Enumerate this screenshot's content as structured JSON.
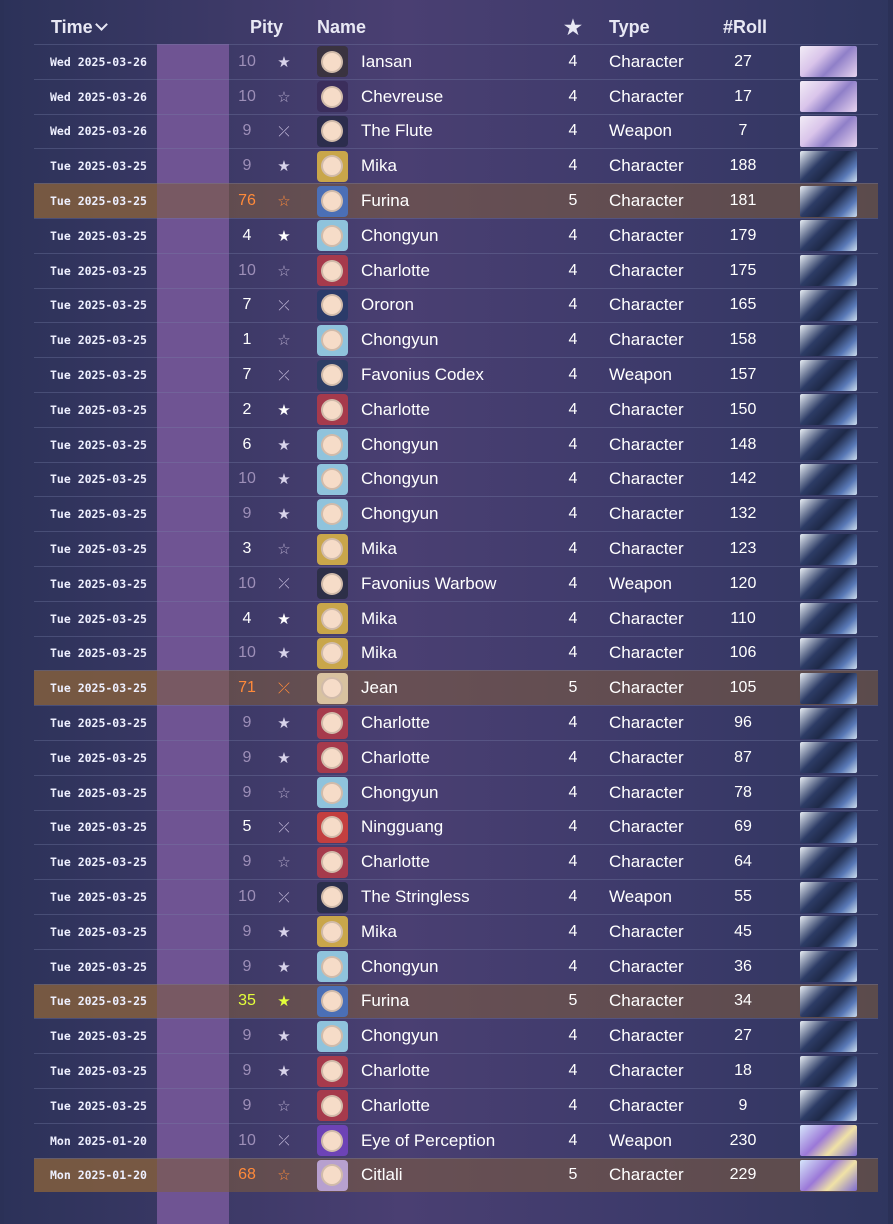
{
  "header": {
    "time": "Time",
    "pity": "Pity",
    "name": "Name",
    "star": "★",
    "type": "Type",
    "roll": "#Roll"
  },
  "rows": [
    {
      "time": "Wed 2025-03-26",
      "pity": "10",
      "icon": "star",
      "name": "Iansan",
      "rarity": "4",
      "type": "Character",
      "roll": "27",
      "banner": "a",
      "hl": "dim"
    },
    {
      "time": "Wed 2025-03-26",
      "pity": "10",
      "icon": "star-outline",
      "name": "Chevreuse",
      "rarity": "4",
      "type": "Character",
      "roll": "17",
      "banner": "a",
      "hl": "dim"
    },
    {
      "time": "Wed 2025-03-26",
      "pity": "9",
      "icon": "slash",
      "name": "The Flute",
      "rarity": "4",
      "type": "Weapon",
      "roll": "7",
      "banner": "a",
      "hl": "dim"
    },
    {
      "time": "Tue 2025-03-25",
      "pity": "9",
      "icon": "star",
      "name": "Mika",
      "rarity": "4",
      "type": "Character",
      "roll": "188",
      "banner": "b",
      "hl": "dim"
    },
    {
      "time": "Tue 2025-03-25",
      "pity": "76",
      "icon": "star-outline",
      "name": "Furina",
      "rarity": "5",
      "type": "Character",
      "roll": "181",
      "banner": "b",
      "hl": "orange"
    },
    {
      "time": "Tue 2025-03-25",
      "pity": "4",
      "icon": "star",
      "name": "Chongyun",
      "rarity": "4",
      "type": "Character",
      "roll": "179",
      "banner": "b",
      "hl": "bright"
    },
    {
      "time": "Tue 2025-03-25",
      "pity": "10",
      "icon": "star-outline",
      "name": "Charlotte",
      "rarity": "4",
      "type": "Character",
      "roll": "175",
      "banner": "b",
      "hl": "dim"
    },
    {
      "time": "Tue 2025-03-25",
      "pity": "7",
      "icon": "slash",
      "name": "Ororon",
      "rarity": "4",
      "type": "Character",
      "roll": "165",
      "banner": "b",
      "hl": "mid"
    },
    {
      "time": "Tue 2025-03-25",
      "pity": "1",
      "icon": "star-outline",
      "name": "Chongyun",
      "rarity": "4",
      "type": "Character",
      "roll": "158",
      "banner": "b",
      "hl": "bright"
    },
    {
      "time": "Tue 2025-03-25",
      "pity": "7",
      "icon": "slash",
      "name": "Favonius Codex",
      "rarity": "4",
      "type": "Weapon",
      "roll": "157",
      "banner": "b",
      "hl": "mid"
    },
    {
      "time": "Tue 2025-03-25",
      "pity": "2",
      "icon": "star",
      "name": "Charlotte",
      "rarity": "4",
      "type": "Character",
      "roll": "150",
      "banner": "b",
      "hl": "bright"
    },
    {
      "time": "Tue 2025-03-25",
      "pity": "6",
      "icon": "star",
      "name": "Chongyun",
      "rarity": "4",
      "type": "Character",
      "roll": "148",
      "banner": "b",
      "hl": "mid"
    },
    {
      "time": "Tue 2025-03-25",
      "pity": "10",
      "icon": "star",
      "name": "Chongyun",
      "rarity": "4",
      "type": "Character",
      "roll": "142",
      "banner": "b",
      "hl": "dim"
    },
    {
      "time": "Tue 2025-03-25",
      "pity": "9",
      "icon": "star",
      "name": "Chongyun",
      "rarity": "4",
      "type": "Character",
      "roll": "132",
      "banner": "b",
      "hl": "dim"
    },
    {
      "time": "Tue 2025-03-25",
      "pity": "3",
      "icon": "star-outline",
      "name": "Mika",
      "rarity": "4",
      "type": "Character",
      "roll": "123",
      "banner": "b",
      "hl": "bright"
    },
    {
      "time": "Tue 2025-03-25",
      "pity": "10",
      "icon": "slash",
      "name": "Favonius Warbow",
      "rarity": "4",
      "type": "Weapon",
      "roll": "120",
      "banner": "b",
      "hl": "dim"
    },
    {
      "time": "Tue 2025-03-25",
      "pity": "4",
      "icon": "star",
      "name": "Mika",
      "rarity": "4",
      "type": "Character",
      "roll": "110",
      "banner": "b",
      "hl": "bright"
    },
    {
      "time": "Tue 2025-03-25",
      "pity": "10",
      "icon": "star",
      "name": "Mika",
      "rarity": "4",
      "type": "Character",
      "roll": "106",
      "banner": "b",
      "hl": "dim"
    },
    {
      "time": "Tue 2025-03-25",
      "pity": "71",
      "icon": "slash",
      "name": "Jean",
      "rarity": "5",
      "type": "Character",
      "roll": "105",
      "banner": "b",
      "hl": "orange"
    },
    {
      "time": "Tue 2025-03-25",
      "pity": "9",
      "icon": "star",
      "name": "Charlotte",
      "rarity": "4",
      "type": "Character",
      "roll": "96",
      "banner": "b",
      "hl": "dim"
    },
    {
      "time": "Tue 2025-03-25",
      "pity": "9",
      "icon": "star",
      "name": "Charlotte",
      "rarity": "4",
      "type": "Character",
      "roll": "87",
      "banner": "b",
      "hl": "dim"
    },
    {
      "time": "Tue 2025-03-25",
      "pity": "9",
      "icon": "star-outline",
      "name": "Chongyun",
      "rarity": "4",
      "type": "Character",
      "roll": "78",
      "banner": "b",
      "hl": "dim"
    },
    {
      "time": "Tue 2025-03-25",
      "pity": "5",
      "icon": "slash",
      "name": "Ningguang",
      "rarity": "4",
      "type": "Character",
      "roll": "69",
      "banner": "b",
      "hl": "bright"
    },
    {
      "time": "Tue 2025-03-25",
      "pity": "9",
      "icon": "star-outline",
      "name": "Charlotte",
      "rarity": "4",
      "type": "Character",
      "roll": "64",
      "banner": "b",
      "hl": "dim"
    },
    {
      "time": "Tue 2025-03-25",
      "pity": "10",
      "icon": "slash",
      "name": "The Stringless",
      "rarity": "4",
      "type": "Weapon",
      "roll": "55",
      "banner": "b",
      "hl": "dim"
    },
    {
      "time": "Tue 2025-03-25",
      "pity": "9",
      "icon": "star",
      "name": "Mika",
      "rarity": "4",
      "type": "Character",
      "roll": "45",
      "banner": "b",
      "hl": "dim"
    },
    {
      "time": "Tue 2025-03-25",
      "pity": "9",
      "icon": "star",
      "name": "Chongyun",
      "rarity": "4",
      "type": "Character",
      "roll": "36",
      "banner": "b",
      "hl": "dim"
    },
    {
      "time": "Tue 2025-03-25",
      "pity": "35",
      "icon": "star",
      "name": "Furina",
      "rarity": "5",
      "type": "Character",
      "roll": "34",
      "banner": "b",
      "hl": "yellow"
    },
    {
      "time": "Tue 2025-03-25",
      "pity": "9",
      "icon": "star",
      "name": "Chongyun",
      "rarity": "4",
      "type": "Character",
      "roll": "27",
      "banner": "b",
      "hl": "dim"
    },
    {
      "time": "Tue 2025-03-25",
      "pity": "9",
      "icon": "star",
      "name": "Charlotte",
      "rarity": "4",
      "type": "Character",
      "roll": "18",
      "banner": "b",
      "hl": "dim"
    },
    {
      "time": "Tue 2025-03-25",
      "pity": "9",
      "icon": "star-outline",
      "name": "Charlotte",
      "rarity": "4",
      "type": "Character",
      "roll": "9",
      "banner": "b",
      "hl": "dim"
    },
    {
      "time": "Mon 2025-01-20",
      "pity": "10",
      "icon": "slash",
      "name": "Eye of Perception",
      "rarity": "4",
      "type": "Weapon",
      "roll": "230",
      "banner": "c",
      "hl": "dim"
    },
    {
      "time": "Mon 2025-01-20",
      "pity": "68",
      "icon": "star-outline",
      "name": "Citlali",
      "rarity": "5",
      "type": "Character",
      "roll": "229",
      "banner": "c",
      "hl": "orange"
    }
  ],
  "colors": {
    "background": "#2b3157",
    "pity_band": "#6f5493",
    "highlight_row": "#805c3c",
    "pity_orange": "#ff8a3a",
    "pity_yellow": "#e4ff3a"
  },
  "avatar_colors": {
    "Iansan": "#3a3340",
    "Chevreuse": "#3b2e5c",
    "The Flute": "#2c2d4d",
    "Mika": "#c9a64a",
    "Furina": "#4b6fb6",
    "Chongyun": "#8fc3dc",
    "Charlotte": "#a63a4c",
    "Ororon": "#2b3b6a",
    "Favonius Codex": "#2e3e66",
    "Favonius Warbow": "#2d2f48",
    "Jean": "#d8c2a0",
    "Ningguang": "#c33f3f",
    "The Stringless": "#2b2f4c",
    "Eye of Perception": "#6d43b6",
    "Citlali": "#b7a0cf"
  }
}
